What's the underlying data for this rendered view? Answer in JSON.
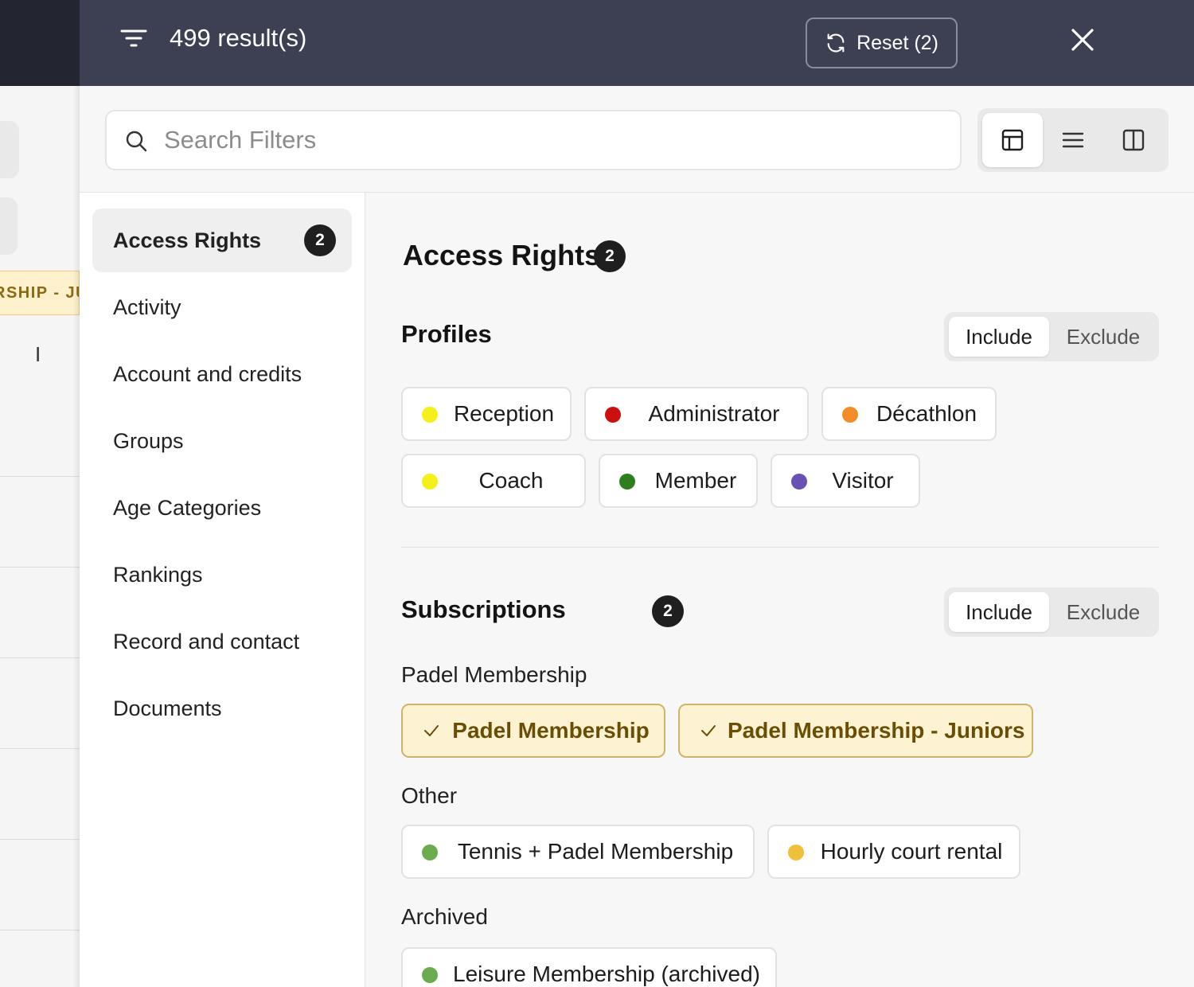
{
  "background": {
    "tag_text": "RSHIP - JU",
    "cursor_text": "I"
  },
  "header": {
    "results": "499 result(s)",
    "reset_label": "Reset (2)"
  },
  "search": {
    "placeholder": "Search Filters"
  },
  "sidebar": {
    "items": [
      {
        "label": "Access Rights",
        "badge": "2"
      },
      {
        "label": "Activity"
      },
      {
        "label": "Account and credits"
      },
      {
        "label": "Groups"
      },
      {
        "label": "Age Categories"
      },
      {
        "label": "Rankings"
      },
      {
        "label": "Record and contact"
      },
      {
        "label": "Documents"
      }
    ]
  },
  "main": {
    "title": "Access Rights",
    "title_badge": "2",
    "profiles": {
      "title": "Profiles",
      "include_label": "Include",
      "exclude_label": "Exclude",
      "chips": [
        {
          "label": "Reception",
          "color": "#f5f01a"
        },
        {
          "label": "Administrator",
          "color": "#cc1010"
        },
        {
          "label": "Décathlon",
          "color": "#f28c28"
        },
        {
          "label": "Coach",
          "color": "#f5f01a"
        },
        {
          "label": "Member",
          "color": "#2e7d1e"
        },
        {
          "label": "Visitor",
          "color": "#6a4fb5"
        }
      ]
    },
    "subscriptions": {
      "title": "Subscriptions",
      "badge": "2",
      "include_label": "Include",
      "exclude_label": "Exclude",
      "groups": [
        {
          "label": "Padel Membership",
          "chips": [
            {
              "label": "Padel Membership",
              "selected": true
            },
            {
              "label": "Padel Membership - Juniors",
              "selected": true
            }
          ]
        },
        {
          "label": "Other",
          "chips": [
            {
              "label": "Tennis + Padel Membership",
              "color": "#6aab4d"
            },
            {
              "label": "Hourly court rental",
              "color": "#f0c03a"
            }
          ]
        },
        {
          "label": "Archived",
          "chips": [
            {
              "label": "Leisure Membership (archived)",
              "color": "#6aab4d"
            }
          ]
        }
      ]
    }
  }
}
